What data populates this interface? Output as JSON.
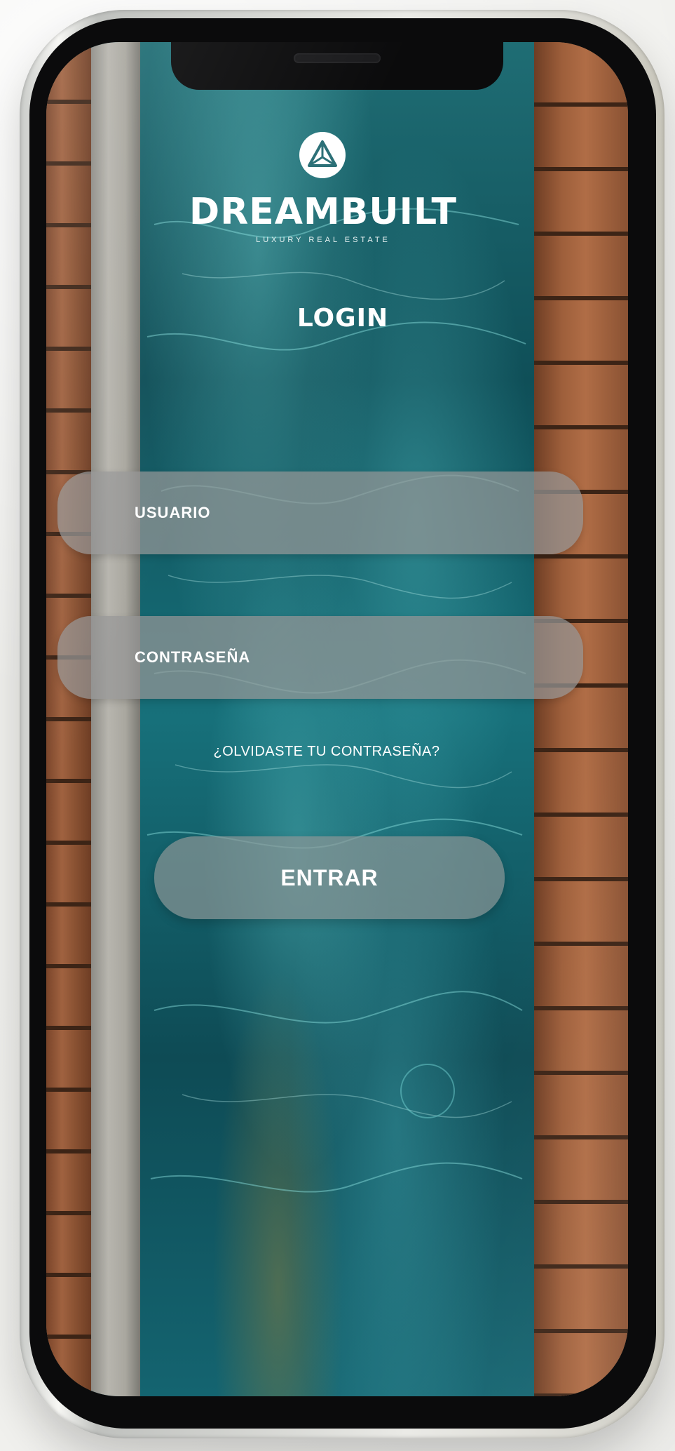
{
  "brand": {
    "name": "DREAMBUILT",
    "tagline": "LUXURY REAL ESTATE",
    "logo_icon": "triangle-emblem-icon",
    "accent_color": "#ffffff"
  },
  "login": {
    "title": "LOGIN",
    "username_placeholder": "USUARIO",
    "password_placeholder": "CONTRASEÑA",
    "forgot_password": "¿OLVIDASTE TU CONTRASEÑA?",
    "submit_label": "ENTRAR"
  },
  "colors": {
    "field_background": "#969696",
    "water": "#1f6d74",
    "deck_wood": "#8a5233"
  }
}
